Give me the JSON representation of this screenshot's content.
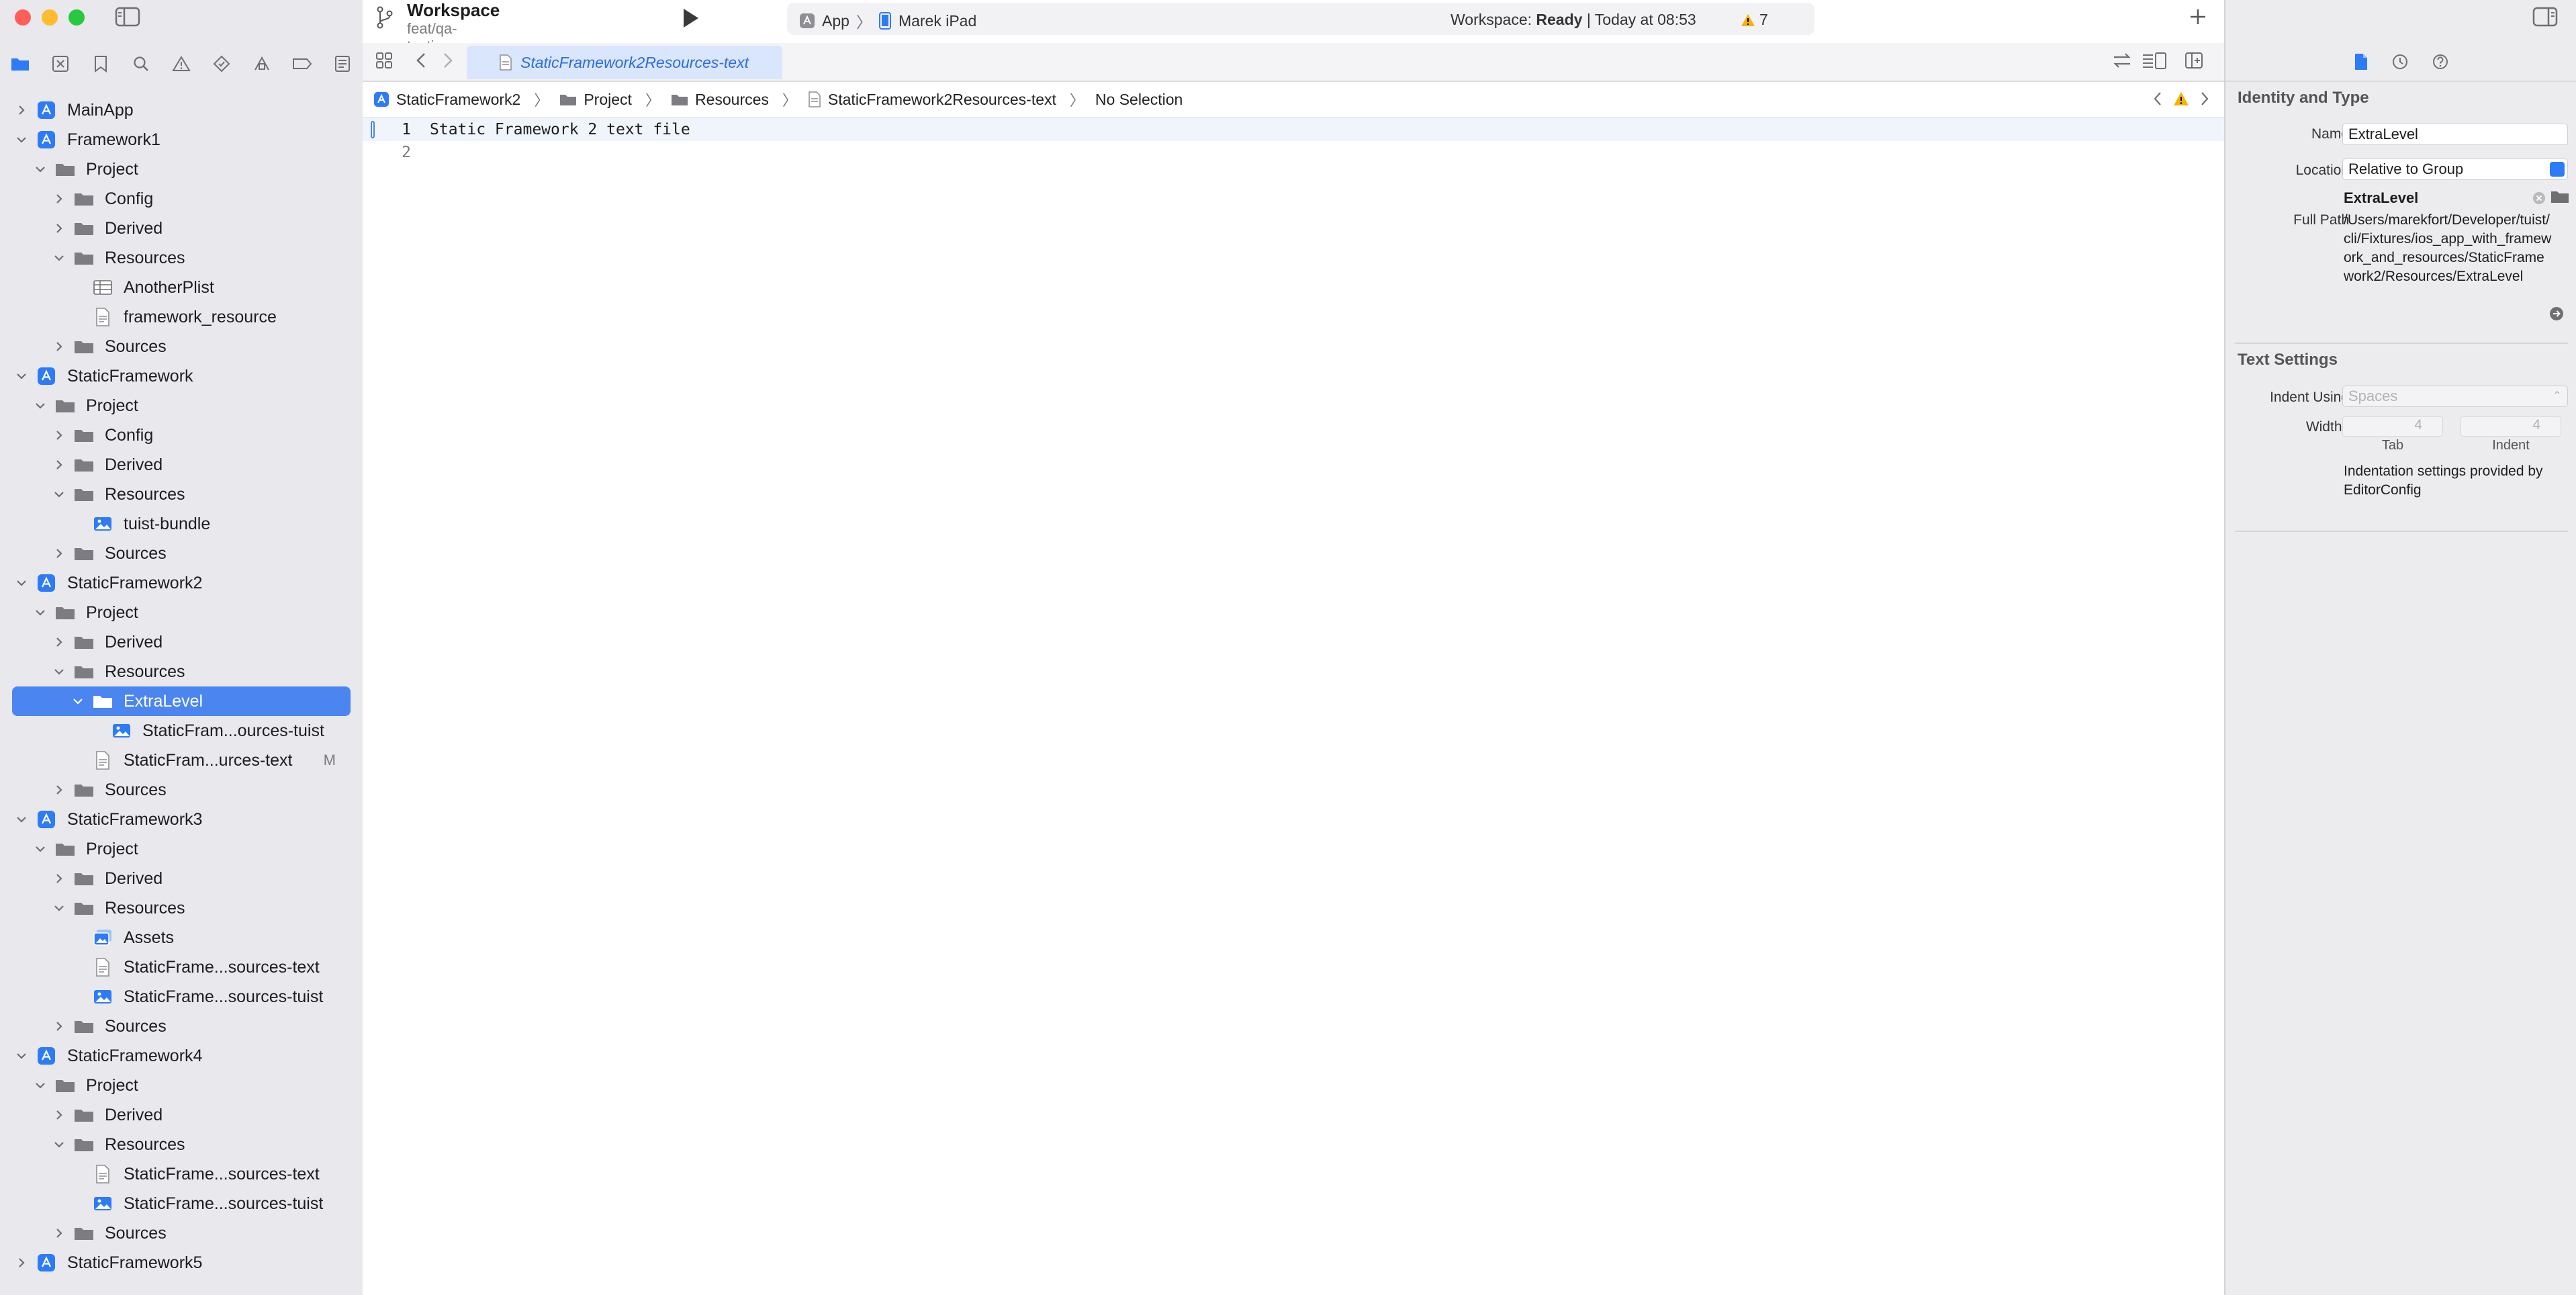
{
  "workspace": {
    "title": "Workspace",
    "branch": "feat/qa-testing"
  },
  "activity": {
    "scheme": "App",
    "device": "Marek iPad",
    "status_prefix": "Workspace:",
    "status_state": "Ready",
    "status_time": "| Today at 08:53",
    "warning_count": "7"
  },
  "tab": {
    "title": "StaticFramework2Resources-text"
  },
  "jumpbar": {
    "items": [
      "StaticFramework2",
      "Project",
      "Resources",
      "StaticFramework2Resources-text",
      "No Selection"
    ]
  },
  "editor": {
    "lines": [
      {
        "number": "1",
        "text": "Static Framework 2 text file"
      },
      {
        "number": "2",
        "text": ""
      }
    ]
  },
  "navigator": {
    "rows": [
      {
        "label": "MainApp",
        "depth": 0,
        "icon": "app-target-icon",
        "expand": "collapsed"
      },
      {
        "label": "Framework1",
        "depth": 0,
        "icon": "app-target-icon",
        "expand": "expanded"
      },
      {
        "label": "Project",
        "depth": 1,
        "icon": "folder-icon",
        "expand": "expanded"
      },
      {
        "label": "Config",
        "depth": 2,
        "icon": "folder-icon",
        "expand": "collapsed"
      },
      {
        "label": "Derived",
        "depth": 2,
        "icon": "folder-icon",
        "expand": "collapsed"
      },
      {
        "label": "Resources",
        "depth": 2,
        "icon": "folder-icon",
        "expand": "expanded"
      },
      {
        "label": "AnotherPlist",
        "depth": 3,
        "icon": "plist-icon",
        "expand": "none"
      },
      {
        "label": "framework_resource",
        "depth": 3,
        "icon": "file-icon",
        "expand": "none"
      },
      {
        "label": "Sources",
        "depth": 2,
        "icon": "folder-icon",
        "expand": "collapsed"
      },
      {
        "label": "StaticFramework",
        "depth": 0,
        "icon": "app-target-icon",
        "expand": "expanded"
      },
      {
        "label": "Project",
        "depth": 1,
        "icon": "folder-icon",
        "expand": "expanded"
      },
      {
        "label": "Config",
        "depth": 2,
        "icon": "folder-icon",
        "expand": "collapsed"
      },
      {
        "label": "Derived",
        "depth": 2,
        "icon": "folder-icon",
        "expand": "collapsed"
      },
      {
        "label": "Resources",
        "depth": 2,
        "icon": "folder-icon",
        "expand": "expanded"
      },
      {
        "label": "tuist-bundle",
        "depth": 3,
        "icon": "image-icon",
        "expand": "none"
      },
      {
        "label": "Sources",
        "depth": 2,
        "icon": "folder-icon",
        "expand": "collapsed"
      },
      {
        "label": "StaticFramework2",
        "depth": 0,
        "icon": "app-target-icon",
        "expand": "expanded"
      },
      {
        "label": "Project",
        "depth": 1,
        "icon": "folder-icon",
        "expand": "expanded"
      },
      {
        "label": "Derived",
        "depth": 2,
        "icon": "folder-icon",
        "expand": "collapsed"
      },
      {
        "label": "Resources",
        "depth": 2,
        "icon": "folder-icon",
        "expand": "expanded"
      },
      {
        "label": "ExtraLevel",
        "depth": 3,
        "icon": "folder-icon",
        "expand": "expanded",
        "selected": true
      },
      {
        "label": "StaticFram...ources-tuist",
        "depth": 4,
        "icon": "image-icon",
        "expand": "none"
      },
      {
        "label": "StaticFram...urces-text",
        "depth": 3,
        "icon": "file-icon",
        "expand": "none",
        "badge": "M"
      },
      {
        "label": "Sources",
        "depth": 2,
        "icon": "folder-icon",
        "expand": "collapsed"
      },
      {
        "label": "StaticFramework3",
        "depth": 0,
        "icon": "app-target-icon",
        "expand": "expanded"
      },
      {
        "label": "Project",
        "depth": 1,
        "icon": "folder-icon",
        "expand": "expanded"
      },
      {
        "label": "Derived",
        "depth": 2,
        "icon": "folder-icon",
        "expand": "collapsed"
      },
      {
        "label": "Resources",
        "depth": 2,
        "icon": "folder-icon",
        "expand": "expanded"
      },
      {
        "label": "Assets",
        "depth": 3,
        "icon": "asset-catalog-icon",
        "expand": "none"
      },
      {
        "label": "StaticFrame...sources-text",
        "depth": 3,
        "icon": "file-icon",
        "expand": "none"
      },
      {
        "label": "StaticFrame...sources-tuist",
        "depth": 3,
        "icon": "image-icon",
        "expand": "none"
      },
      {
        "label": "Sources",
        "depth": 2,
        "icon": "folder-icon",
        "expand": "collapsed"
      },
      {
        "label": "StaticFramework4",
        "depth": 0,
        "icon": "app-target-icon",
        "expand": "expanded"
      },
      {
        "label": "Project",
        "depth": 1,
        "icon": "folder-icon",
        "expand": "expanded"
      },
      {
        "label": "Derived",
        "depth": 2,
        "icon": "folder-icon",
        "expand": "collapsed"
      },
      {
        "label": "Resources",
        "depth": 2,
        "icon": "folder-icon",
        "expand": "expanded"
      },
      {
        "label": "StaticFrame...sources-text",
        "depth": 3,
        "icon": "file-icon",
        "expand": "none"
      },
      {
        "label": "StaticFrame...sources-tuist",
        "depth": 3,
        "icon": "image-icon",
        "expand": "none"
      },
      {
        "label": "Sources",
        "depth": 2,
        "icon": "folder-icon",
        "expand": "collapsed"
      },
      {
        "label": "StaticFramework5",
        "depth": 0,
        "icon": "app-target-icon",
        "expand": "collapsed"
      }
    ]
  },
  "inspector": {
    "identity_title": "Identity and Type",
    "name_label": "Name",
    "name_value": "ExtraLevel",
    "location_label": "Location",
    "location_value": "Relative to Group",
    "location_file": "ExtraLevel",
    "full_path_label": "Full Path",
    "full_path_value": "/Users/marekfort/Developer/tuist/cli/Fixtures/ios_app_with_framework_and_resources/StaticFramework2/Resources/ExtraLevel",
    "text_settings_title": "Text Settings",
    "indent_using_label": "Indent Using",
    "indent_using_value": "Spaces",
    "widths_label": "Widths",
    "tab_width": "4",
    "indent_width": "4",
    "tab_label": "Tab",
    "indent_label": "Indent",
    "editorconfig_note": "Indentation settings provided by EditorConfig"
  },
  "colors": {
    "accent": "#4a85f0",
    "sidebar_bg": "#e9e8ed",
    "target_icon": "#2d7bf6",
    "folder_icon": "#7c7c82",
    "warning": "#f5b400"
  }
}
